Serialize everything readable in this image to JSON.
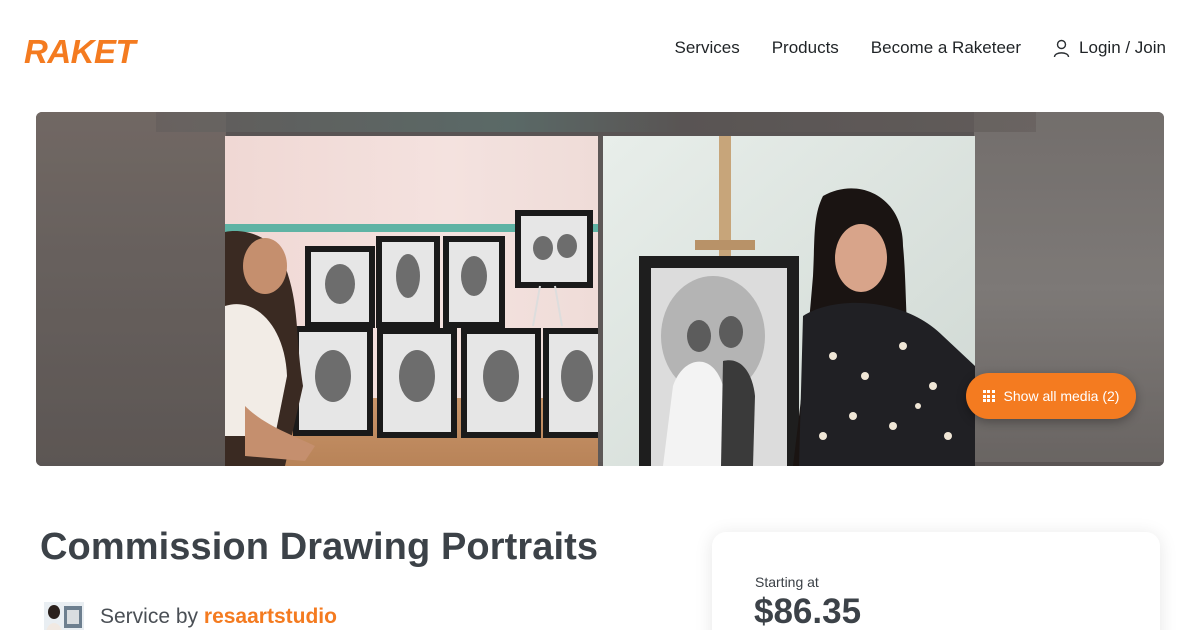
{
  "brand": {
    "logo_text": "RAKET",
    "accent": "#f47b20"
  },
  "nav": {
    "items": [
      {
        "label": "Services"
      },
      {
        "label": "Products"
      },
      {
        "label": "Become a Raketeer"
      }
    ],
    "login": {
      "label": "Login / Join",
      "icon": "user-icon"
    }
  },
  "gallery": {
    "media_button": {
      "label": "Show all media (2)",
      "icon": "grid-icon"
    },
    "images": [
      "portrait-display-photo",
      "wedding-portrait-photo"
    ]
  },
  "service": {
    "title": "Commission Drawing Portraits",
    "byline_prefix": "Service by",
    "seller": "resaartstudio"
  },
  "pricing": {
    "label": "Starting at",
    "price": "$86.35"
  }
}
